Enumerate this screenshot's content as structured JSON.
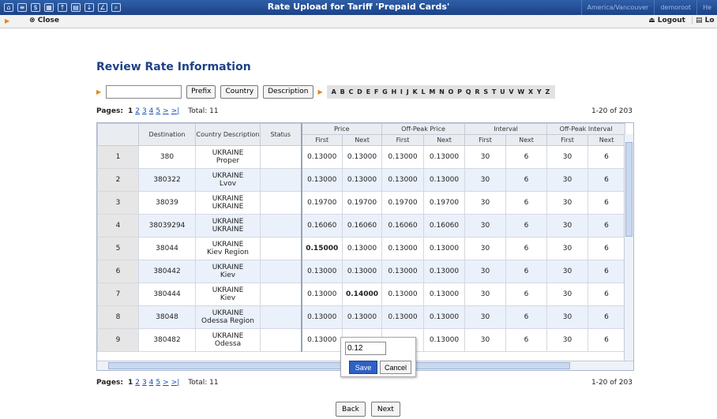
{
  "window": {
    "title": "Rate Upload for Tariff 'Prepaid Cards'",
    "timezone": "America/Vancouver",
    "user": "demoroot",
    "help": "He"
  },
  "toolbar": {
    "close_label": "Close",
    "logout_label": "Logout",
    "log_label": "Lo"
  },
  "page": {
    "heading": "Review Rate Information"
  },
  "filter": {
    "search_value": "",
    "buttons": [
      "Prefix",
      "Country",
      "Description"
    ],
    "alphabet": "A B C D E F G H I J K L M N O P Q R S T U V W X Y Z"
  },
  "pagination": {
    "label": "Pages:",
    "current": "1",
    "pages": [
      "2",
      "3",
      "4",
      "5",
      ">",
      ">|"
    ],
    "total": "Total: 11",
    "range": "1-20 of 203"
  },
  "table": {
    "headers": {
      "destination": "Destination",
      "country_description": "Country Description",
      "status": "Status",
      "price": "Price",
      "offpeak_price": "Off-Peak Price",
      "interval": "Interval",
      "offpeak_interval": "Off-Peak Interval",
      "first": "First",
      "next": "Next"
    },
    "rows": [
      {
        "n": "1",
        "dest": "380",
        "country": "UKRAINE",
        "desc": "Proper",
        "p1": "0.13000",
        "p2": "0.13000",
        "o1": "0.13000",
        "o2": "0.13000",
        "i1": "30",
        "i2": "6",
        "oi1": "30",
        "oi2": "6",
        "bold": ""
      },
      {
        "n": "2",
        "dest": "380322",
        "country": "UKRAINE",
        "desc": "Lvov",
        "p1": "0.13000",
        "p2": "0.13000",
        "o1": "0.13000",
        "o2": "0.13000",
        "i1": "30",
        "i2": "6",
        "oi1": "30",
        "oi2": "6",
        "bold": ""
      },
      {
        "n": "3",
        "dest": "38039",
        "country": "UKRAINE",
        "desc": "UKRAINE",
        "p1": "0.19700",
        "p2": "0.19700",
        "o1": "0.19700",
        "o2": "0.19700",
        "i1": "30",
        "i2": "6",
        "oi1": "30",
        "oi2": "6",
        "bold": ""
      },
      {
        "n": "4",
        "dest": "38039294",
        "country": "UKRAINE",
        "desc": "UKRAINE",
        "p1": "0.16060",
        "p2": "0.16060",
        "o1": "0.16060",
        "o2": "0.16060",
        "i1": "30",
        "i2": "6",
        "oi1": "30",
        "oi2": "6",
        "bold": ""
      },
      {
        "n": "5",
        "dest": "38044",
        "country": "UKRAINE",
        "desc": "Kiev Region",
        "p1": "0.15000",
        "p2": "0.13000",
        "o1": "0.13000",
        "o2": "0.13000",
        "i1": "30",
        "i2": "6",
        "oi1": "30",
        "oi2": "6",
        "bold": "p1"
      },
      {
        "n": "6",
        "dest": "380442",
        "country": "UKRAINE",
        "desc": "Kiev",
        "p1": "0.13000",
        "p2": "0.13000",
        "o1": "0.13000",
        "o2": "0.13000",
        "i1": "30",
        "i2": "6",
        "oi1": "30",
        "oi2": "6",
        "bold": ""
      },
      {
        "n": "7",
        "dest": "380444",
        "country": "UKRAINE",
        "desc": "Kiev",
        "p1": "0.13000",
        "p2": "0.14000",
        "o1": "0.13000",
        "o2": "0.13000",
        "i1": "30",
        "i2": "6",
        "oi1": "30",
        "oi2": "6",
        "bold": "p2"
      },
      {
        "n": "8",
        "dest": "38048",
        "country": "UKRAINE",
        "desc": "Odessa Region",
        "p1": "0.13000",
        "p2": "0.13000",
        "o1": "0.13000",
        "o2": "0.13000",
        "i1": "30",
        "i2": "6",
        "oi1": "30",
        "oi2": "6",
        "bold": ""
      },
      {
        "n": "9",
        "dest": "380482",
        "country": "UKRAINE",
        "desc": "Odessa",
        "p1": "0.13000",
        "p2": "",
        "o1": "",
        "o2": "0.13000",
        "i1": "30",
        "i2": "6",
        "oi1": "30",
        "oi2": "6",
        "bold": ""
      }
    ]
  },
  "editor": {
    "value": "0.12",
    "save_label": "Save",
    "cancel_label": "Cancel"
  },
  "footer": {
    "back_label": "Back",
    "next_label": "Next"
  },
  "colors": {
    "brand": "#1c4286",
    "accent": "#e8841a",
    "link": "#1a4fb0",
    "alt_row": "#eaf1fb"
  }
}
